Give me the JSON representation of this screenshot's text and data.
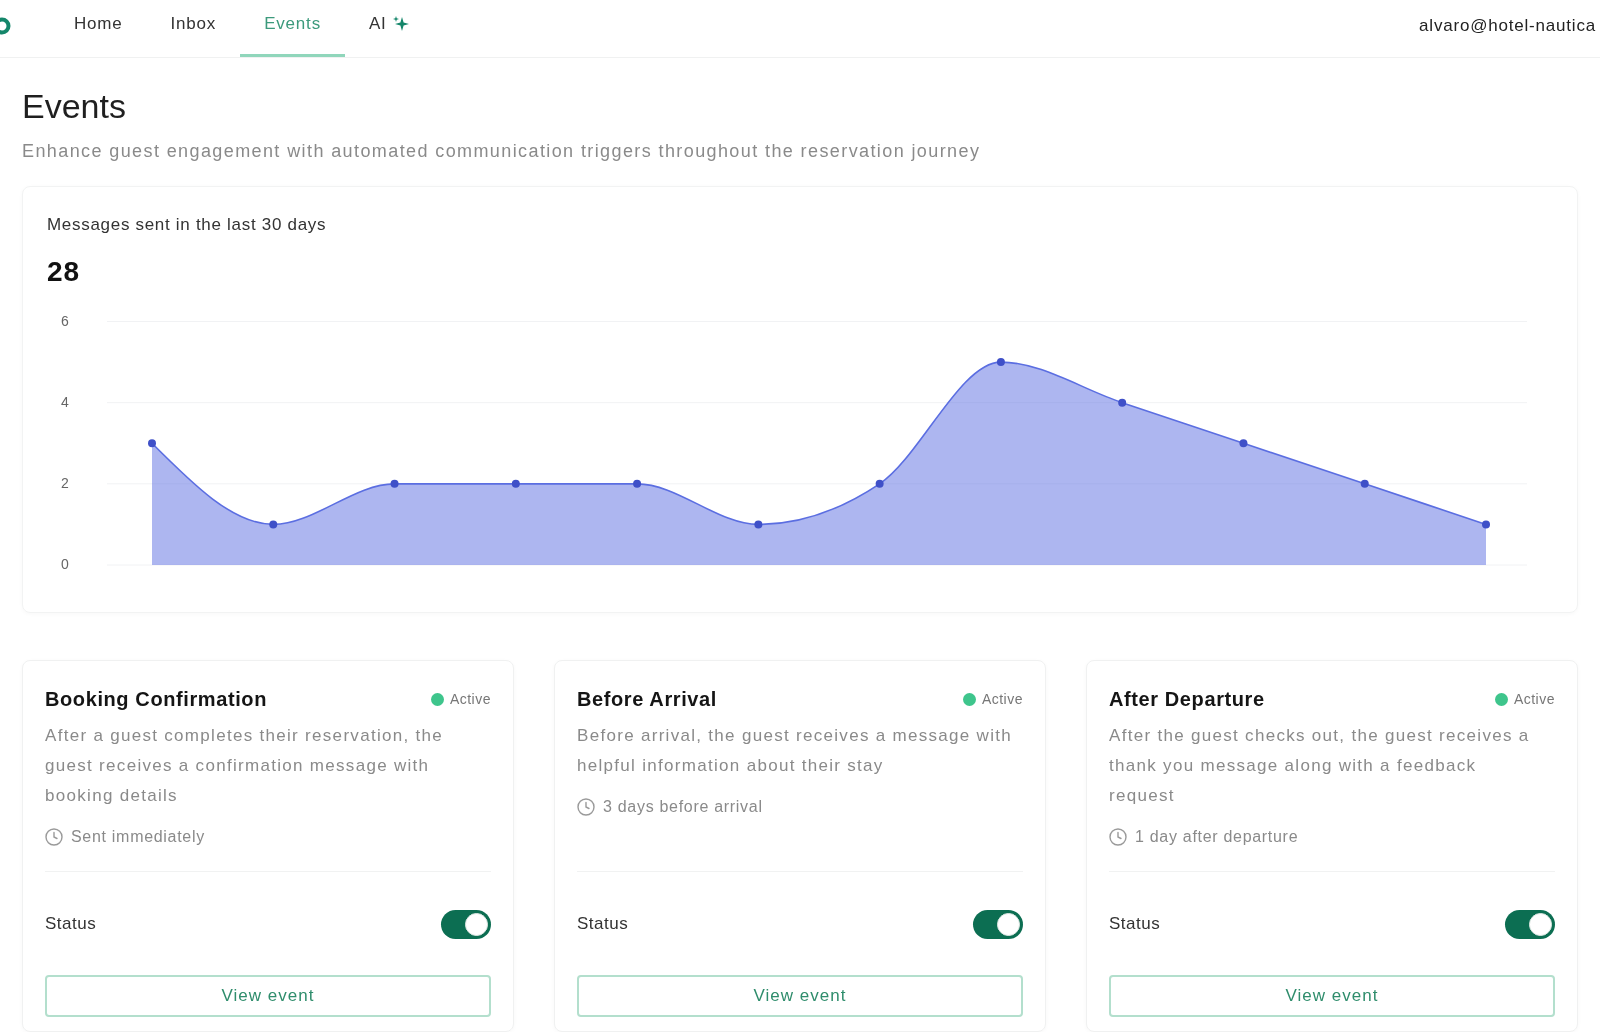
{
  "nav": {
    "tabs": [
      {
        "label": "Home",
        "kind": "plain",
        "selected": false
      },
      {
        "label": "Inbox",
        "kind": "plain",
        "selected": false
      },
      {
        "label": "Events",
        "kind": "plain",
        "selected": true
      },
      {
        "label": "AI",
        "kind": "assistant",
        "selected": false
      }
    ],
    "account": "alvaro@hotel-nautica"
  },
  "header": {
    "title": "Events",
    "subtitle": "Enhance guest engagement with automated communication triggers throughout the reservation journey"
  },
  "summary": {
    "label": "Messages sent in the last 30 days",
    "total": "28",
    "chart_data": [
      {
        "type": "area",
        "categories": [
          null,
          null,
          null,
          null,
          null,
          null,
          null,
          null,
          null,
          null,
          null,
          null
        ],
        "values": [
          3,
          1,
          2,
          2,
          2,
          1,
          2,
          5,
          4,
          3,
          2,
          1
        ],
        "color": "#5b6ee1",
        "ylim": [
          0,
          6
        ],
        "yticks": [
          0,
          2,
          4,
          6
        ],
        "tick_labels": "y",
        "grid": true,
        "marker": "circle"
      }
    ]
  },
  "events": [
    {
      "title": "Booking Confirmation",
      "state": "Active",
      "description": "After a guest completes their reservation, the guest receives a confirmation message with booking details",
      "timing": "Sent immediately",
      "status_label": "Status",
      "on": true,
      "button": "View event"
    },
    {
      "title": "Before Arrival",
      "state": "Active",
      "description": "Before arrival, the guest receives a message with helpful information about their stay",
      "timing": "3 days before arrival",
      "status_label": "Status",
      "on": true,
      "button": "View event"
    },
    {
      "title": "After Departure",
      "state": "Active",
      "description": "After the guest checks out, the guest receives a thank you message along with a feedback request",
      "timing": "1 day after departure",
      "status_label": "Status",
      "on": true,
      "button": "View event"
    }
  ]
}
